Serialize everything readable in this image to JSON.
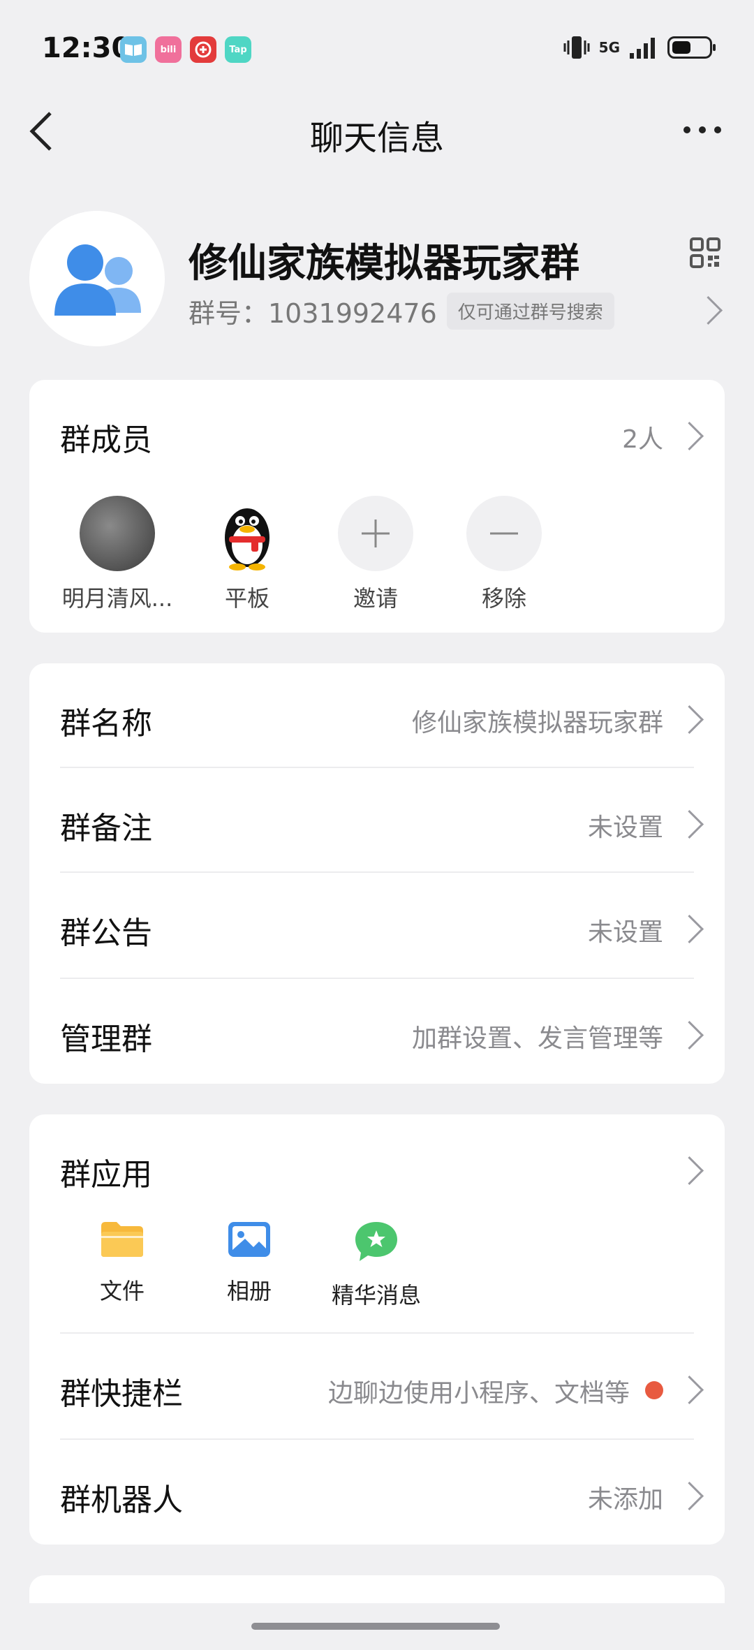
{
  "status_bar": {
    "time": "12:30",
    "network": "5G",
    "apps": [
      {
        "name": "book-app-icon",
        "color": "#6ec2e6",
        "text": ""
      },
      {
        "name": "bilibili-app-icon",
        "color": "#f0709b",
        "text": "bili"
      },
      {
        "name": "red-app-icon",
        "color": "#e33b3b",
        "text": ""
      },
      {
        "name": "taptap-app-icon",
        "color": "#4fd6c4",
        "text": "Tap"
      }
    ],
    "battery_level": 0.45
  },
  "nav": {
    "title": "聊天信息"
  },
  "group": {
    "name": "修仙家族模拟器玩家群",
    "id_label": "群号：1031992476",
    "search_tag": "仅可通过群号搜索"
  },
  "members_section": {
    "label": "群成员",
    "count": "2人",
    "members": [
      {
        "name": "明月清风..."
      },
      {
        "name": "平板"
      }
    ],
    "invite_label": "邀请",
    "remove_label": "移除"
  },
  "info_rows": [
    {
      "label": "群名称",
      "value": "修仙家族模拟器玩家群"
    },
    {
      "label": "群备注",
      "value": "未设置"
    },
    {
      "label": "群公告",
      "value": "未设置"
    },
    {
      "label": "管理群",
      "value": "加群设置、发言管理等"
    }
  ],
  "apps_section": {
    "label": "群应用",
    "items": [
      {
        "label": "文件",
        "icon": "folder-icon"
      },
      {
        "label": "相册",
        "icon": "album-icon"
      },
      {
        "label": "精华消息",
        "icon": "highlight-message-icon"
      }
    ],
    "shortcut": {
      "label": "群快捷栏",
      "value": "边聊边使用小程序、文档等"
    },
    "robot": {
      "label": "群机器人",
      "value": "未添加"
    }
  },
  "colors": {
    "accent_blue": "#3f8de8",
    "red_dot": "#e85a40",
    "background": "#f0f0f2"
  }
}
